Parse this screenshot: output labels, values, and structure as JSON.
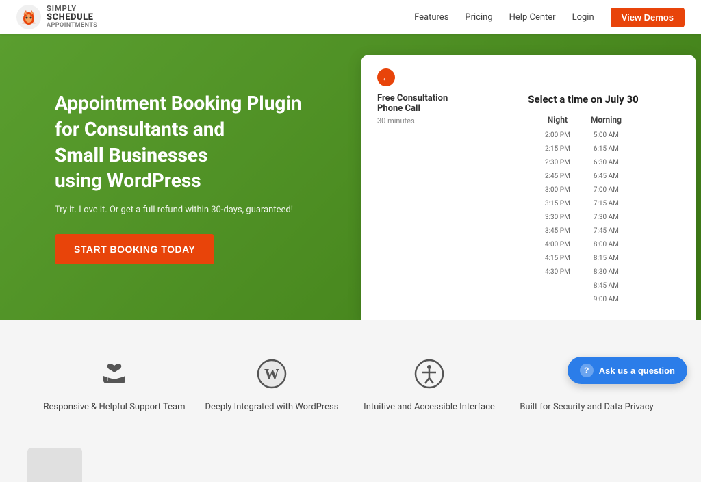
{
  "header": {
    "logo": {
      "simply": "SIMPLY",
      "schedule": "SCHEDULE",
      "appointments": "APPOINTMENTS"
    },
    "nav": {
      "features": "Features",
      "pricing": "Pricing",
      "help_center": "Help Center",
      "login": "Login",
      "view_demos": "View Demos"
    }
  },
  "hero": {
    "title_line1": "Appointment Booking Plugin",
    "title_line2": "for ",
    "title_consultants": "Consultants",
    "title_line3": " and",
    "title_line4": "Small Businesses",
    "title_line5": "using WordPress",
    "subtitle": "Try it. Love it. Or get a full refund within 30-days, guaranteed!",
    "cta_button": "START BOOKING TODAY"
  },
  "widget": {
    "back_arrow": "←",
    "service_name": "Free Consultation Phone Call",
    "duration": "30 minutes",
    "select_time_label": "Select a time on July 30",
    "night_label": "Night",
    "morning_label": "Morning",
    "night_slots": [
      "2:00 PM",
      "2:15 PM",
      "2:30 PM",
      "2:45 PM",
      "3:00 PM",
      "3:15 PM",
      "3:30 PM",
      "3:45 PM",
      "4:00 PM",
      "4:15 PM",
      "4:30 PM"
    ],
    "morning_slots": [
      "5:00 AM",
      "6:15 AM",
      "6:30 AM",
      "6:45 AM",
      "7:00 AM",
      "7:15 AM",
      "7:30 AM",
      "7:45 AM",
      "8:00 AM",
      "8:15 AM",
      "8:30 AM",
      "8:45 AM",
      "9:00 AM"
    ]
  },
  "features": [
    {
      "id": "support",
      "label": "Responsive & Helpful Support Team",
      "icon": "heart-hands"
    },
    {
      "id": "wordpress",
      "label": "Deeply Integrated with WordPress",
      "icon": "wordpress"
    },
    {
      "id": "accessible",
      "label": "Intuitive and Accessible Interface",
      "icon": "accessibility"
    },
    {
      "id": "security",
      "label": "Built for Security and Data Privacy",
      "icon": "security"
    }
  ],
  "ask_button": {
    "label": "Ask us a question",
    "icon": "question-mark"
  }
}
